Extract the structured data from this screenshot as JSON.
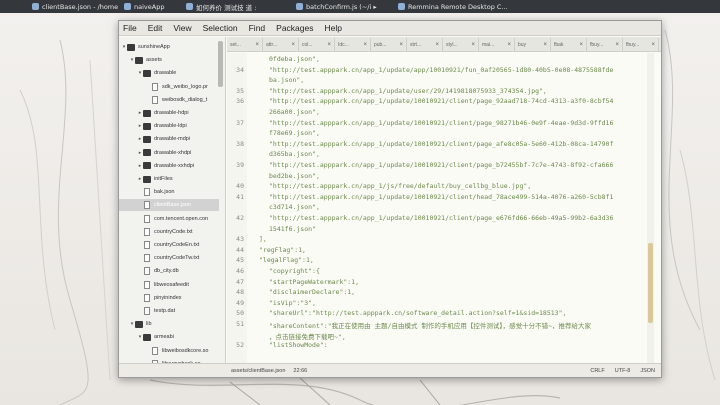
{
  "taskbar": [
    {
      "label": "clientBase.json - /home/..."
    },
    {
      "label": "naiveApp"
    },
    {
      "label": "如何养价 测试技 道 :"
    },
    {
      "label": "batchConfirm.js (~/i ▸"
    },
    {
      "label": "Remmina Remote Desktop C..."
    }
  ],
  "menu": [
    "File",
    "Edit",
    "View",
    "Selection",
    "Find",
    "Packages",
    "Help"
  ],
  "tree": [
    {
      "label": "sunshineApp",
      "type": "folder",
      "arrow": "▾"
    },
    {
      "label": "assets",
      "type": "folder",
      "arrow": "▾"
    },
    {
      "label": "drawable",
      "type": "folder",
      "arrow": "▾"
    },
    {
      "label": "sdk_weibo_logo.pr",
      "type": "file",
      "arrow": ""
    },
    {
      "label": "weibosdk_dialog_t",
      "type": "file",
      "arrow": ""
    },
    {
      "label": "drawable-hdpi",
      "type": "folder",
      "arrow": "▸"
    },
    {
      "label": "drawable-ldpi",
      "type": "folder",
      "arrow": "▸"
    },
    {
      "label": "drawable-mdpi",
      "type": "folder",
      "arrow": "▸"
    },
    {
      "label": "drawable-xhdpi",
      "type": "folder",
      "arrow": "▸"
    },
    {
      "label": "drawable-xxhdpi",
      "type": "folder",
      "arrow": "▸"
    },
    {
      "label": "initFiles",
      "type": "folder",
      "arrow": "▸"
    },
    {
      "label": "bak.json",
      "type": "file",
      "arrow": ""
    },
    {
      "label": "clientBase.json",
      "type": "file",
      "arrow": "",
      "selected": true
    },
    {
      "label": "com.tencent.open.con",
      "type": "file",
      "arrow": ""
    },
    {
      "label": "countryCode.txt",
      "type": "file",
      "arrow": ""
    },
    {
      "label": "countryCodeEn.txt",
      "type": "file",
      "arrow": ""
    },
    {
      "label": "countryCodeTw.txt",
      "type": "file",
      "arrow": ""
    },
    {
      "label": "db_city.db",
      "type": "file",
      "arrow": ""
    },
    {
      "label": "libweosafeedit",
      "type": "file",
      "arrow": ""
    },
    {
      "label": "pinyinindex",
      "type": "file",
      "arrow": ""
    },
    {
      "label": "testp.dat",
      "type": "file",
      "arrow": ""
    },
    {
      "label": "lib",
      "type": "folder",
      "arrow": "▾"
    },
    {
      "label": "armeabi",
      "type": "folder",
      "arrow": "▾"
    },
    {
      "label": "libweibosdkcore.so",
      "type": "file",
      "arrow": ""
    },
    {
      "label": "libyygycheck.so",
      "type": "file",
      "arrow": ""
    }
  ],
  "tabs": [
    "set...",
    "attr...",
    "col...",
    "Idc...",
    "pub...",
    "strt...",
    "styl...",
    "mai...",
    "buy",
    "fbak",
    "fbuy...",
    "fbuy...",
    "bbb"
  ],
  "code": [
    {
      "ln": "",
      "text": "0fdeba.json\","
    },
    {
      "ln": "34",
      "text": "\"http://test.apppark.cn/app_1/update/app/10010921/fun_0af20565-1d80-40b5-0e08-4875588fde"
    },
    {
      "ln": "",
      "text": "ba.json\","
    },
    {
      "ln": "35",
      "text": "\"http://test.apppark.cn/app_1/update/user/29/1419818075933_374354.jpg\","
    },
    {
      "ln": "36",
      "text": "\"http://test.apppark.cn/app_1/update/10010921/client/page_92aad718-74cd-4313-a3f0-8cbf54"
    },
    {
      "ln": "",
      "text": "266a00.json\","
    },
    {
      "ln": "37",
      "text": "\"http://test.apppark.cn/app_1/update/10010921/client/page_98271b46-0e9f-4eae-9d3d-9ffd16"
    },
    {
      "ln": "",
      "text": "f78e69.json\","
    },
    {
      "ln": "38",
      "text": "\"http://test.apppark.cn/app_1/update/10010921/client/page_afe8c05a-5e60-412b-08ca-14790f"
    },
    {
      "ln": "",
      "text": "d365ba.json\","
    },
    {
      "ln": "39",
      "text": "\"http://test.apppark.cn/app_1/update/10010921/client/page_b72455bf-7c7e-4743-8f92-cfa666"
    },
    {
      "ln": "",
      "text": "bed2be.json\","
    },
    {
      "ln": "40",
      "text": "\"http://test.apppark.cn/app_1/js/free/default/buy_cellbg_blue.jpg\","
    },
    {
      "ln": "41",
      "text": "\"http://test.apppark.cn/app_1/update/10010921/client/head_78ace499-514a-4076-a260-5cb8f1"
    },
    {
      "ln": "",
      "text": "c3d714.json\","
    },
    {
      "ln": "42",
      "text": "\"http://test.apppark.cn/app_1/update/10010921/client/page_e676fd66-66eb-49a5-99b2-6a3d36"
    },
    {
      "ln": "",
      "text": "1541f6.json\""
    },
    {
      "ln": "43",
      "text": "],"
    },
    {
      "ln": "44",
      "text": "\"regFlag\":1,"
    },
    {
      "ln": "45",
      "text": "\"legalFlag\":1,"
    },
    {
      "ln": "46",
      "text": "\"copyright\":{"
    },
    {
      "ln": "47",
      "text": "\"startPageWatermark\":1,"
    },
    {
      "ln": "48",
      "text": "\"disclaimerDeclare\":1,"
    },
    {
      "ln": "49",
      "text": "\"isVip\":\"3\","
    },
    {
      "ln": "50",
      "text": "\"shareUrl\":\"http://test.apppark.cn/software_detail.action?self=1&sid=18513\","
    },
    {
      "ln": "51",
      "text": "\"shareContent\":\"我正在使用由 主题/自由模式 制作的手机应用【控件测试】，感觉十分不错~，推荐给大家"
    },
    {
      "ln": "",
      "text": "，点击链接免费下载吧~\","
    },
    {
      "ln": "52",
      "text": "\"listShowMode\":"
    }
  ],
  "status": {
    "path": "assets/clientBase.json",
    "pos": "22:66",
    "eol": "CRLF",
    "encoding": "UTF-8",
    "grammar": "JSON"
  }
}
